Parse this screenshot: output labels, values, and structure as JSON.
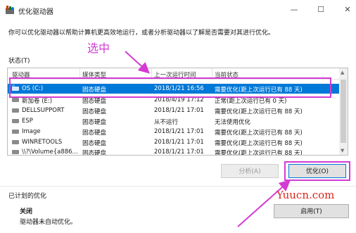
{
  "window": {
    "title": "优化驱动器",
    "minimize_glyph": "—",
    "maximize_glyph": "☐",
    "close_glyph": "✕",
    "icon": "defrag-icon"
  },
  "description": "你可以优化驱动器以帮助计算机更高效地运行，或者分析驱动器以了解是否需要对其进行优化。",
  "status_label": "状态(T)",
  "annotation": "选中",
  "drive_list": {
    "columns": [
      "驱动器",
      "媒体类型",
      "上一次运行时间",
      "当前状态"
    ],
    "rows": [
      {
        "drive": "OS (C:)",
        "media": "固态硬盘",
        "last_run": "2018/1/21 16:56",
        "status": "需要优化(距上次运行已有 88 天)"
      },
      {
        "drive": "新加卷 (E:)",
        "media": "固态硬盘",
        "last_run": "2018/4/19 17:12",
        "status": "正常(距上次运行已有 0 天)"
      },
      {
        "drive": "DELLSUPPORT",
        "media": "固态硬盘",
        "last_run": "2018/1/21 17:01",
        "status": "需要优化(距上次运行已有 88 天)"
      },
      {
        "drive": "ESP",
        "media": "固态硬盘",
        "last_run": "从不运行",
        "status": "无法使用优化"
      },
      {
        "drive": "Image",
        "media": "固态硬盘",
        "last_run": "2018/1/21 17:01",
        "status": "需要优化(距上次运行已有 88 天)"
      },
      {
        "drive": "WINRETOOLS",
        "media": "固态硬盘",
        "last_run": "2018/1/21 17:01",
        "status": "需要优化(距上次运行已有 88 天)"
      },
      {
        "drive": "\\\\?\\Volume{a886...",
        "media": "固态硬盘",
        "last_run": "2018/1/21 17:01",
        "status": "需要优化(距上次运行已有 88 天)"
      }
    ],
    "selected_index": 0
  },
  "buttons": {
    "analyze": "分析(A)",
    "optimize": "优化(O)",
    "enable": "启用(T)"
  },
  "scheduled": {
    "heading": "已计划的优化",
    "status": "关闭",
    "detail": "驱动器未自动优化。"
  },
  "watermark": "Yuucn.com",
  "colors": {
    "selection": "#0078d7",
    "annotation": "#d43bd3",
    "watermark": "#d9261c"
  }
}
